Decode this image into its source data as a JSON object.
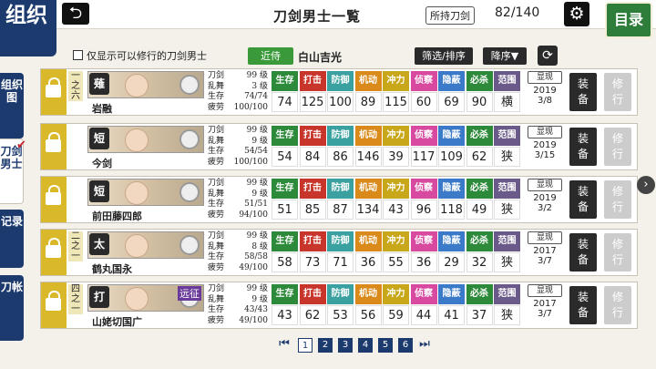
{
  "header": {
    "logo_text": "组织",
    "title": "刀剑男士一覧",
    "owned_label": "所持刀剑",
    "owned_value": "82/140",
    "menu_label": "目录"
  },
  "filter": {
    "trainable_only_label": "仅显示可以修行的刀剑男士",
    "recent_label": "近侍",
    "recent_name": "白山吉光",
    "sort_label": "筛选/排序",
    "order_label": "降序▼"
  },
  "sidebar": {
    "items": [
      {
        "label": "组织图"
      },
      {
        "label": "刀剑男士"
      },
      {
        "label": "记录"
      },
      {
        "label": "刀帐"
      }
    ]
  },
  "stat_headers": [
    "生存",
    "打击",
    "防御",
    "机动",
    "冲力",
    "侦察",
    "隐蔽",
    "必杀",
    "范围"
  ],
  "stat_colors": [
    "#2d8a3a",
    "#c8352a",
    "#3aa0a0",
    "#d98a1a",
    "#c8a81a",
    "#d74aa0",
    "#3a7ac8",
    "#2d8a3a",
    "#6a5a8a"
  ],
  "meta_labels": {
    "sword": "刀剑",
    "dance": "乱舞",
    "hp": "生存",
    "fatigue": "疲劳",
    "unit": "级"
  },
  "visible_label": "显现",
  "equip_label": "装备",
  "train_label": "修行",
  "rows": [
    {
      "unit": "一之六",
      "type": "薙",
      "name": "岩融",
      "sword_lv": "99",
      "dance_lv": "3",
      "hp": "74/74",
      "fatigue": "100/100",
      "stats": [
        "74",
        "125",
        "100",
        "89",
        "115",
        "60",
        "69",
        "90",
        "横"
      ],
      "year": "2019",
      "day": "3/8",
      "expedition": ""
    },
    {
      "unit": "",
      "type": "短",
      "name": "今剑",
      "sword_lv": "99",
      "dance_lv": "9",
      "hp": "54/54",
      "fatigue": "100/100",
      "stats": [
        "54",
        "84",
        "86",
        "146",
        "39",
        "117",
        "109",
        "62",
        "狭"
      ],
      "year": "2019",
      "day": "3/15",
      "expedition": ""
    },
    {
      "unit": "",
      "type": "短",
      "name": "前田藤四郎",
      "sword_lv": "99",
      "dance_lv": "9",
      "hp": "51/51",
      "fatigue": "94/100",
      "stats": [
        "51",
        "85",
        "87",
        "134",
        "43",
        "96",
        "118",
        "49",
        "狭"
      ],
      "year": "2019",
      "day": "3/2",
      "expedition": ""
    },
    {
      "unit": "二之一",
      "type": "太",
      "name": "鹤丸国永",
      "sword_lv": "99",
      "dance_lv": "8",
      "hp": "58/58",
      "fatigue": "49/100",
      "stats": [
        "58",
        "73",
        "71",
        "36",
        "55",
        "36",
        "29",
        "32",
        "狭"
      ],
      "year": "2017",
      "day": "3/7",
      "expedition": ""
    },
    {
      "unit": "四之一",
      "type": "打",
      "name": "山姥切国广",
      "sword_lv": "99",
      "dance_lv": "9",
      "hp": "43/43",
      "fatigue": "49/100",
      "stats": [
        "43",
        "62",
        "53",
        "56",
        "59",
        "44",
        "41",
        "37",
        "狭"
      ],
      "year": "2017",
      "day": "3/7",
      "expedition": "远征"
    }
  ],
  "pager": {
    "pages": [
      "1",
      "2",
      "3",
      "4",
      "5",
      "6"
    ],
    "current": "1"
  }
}
